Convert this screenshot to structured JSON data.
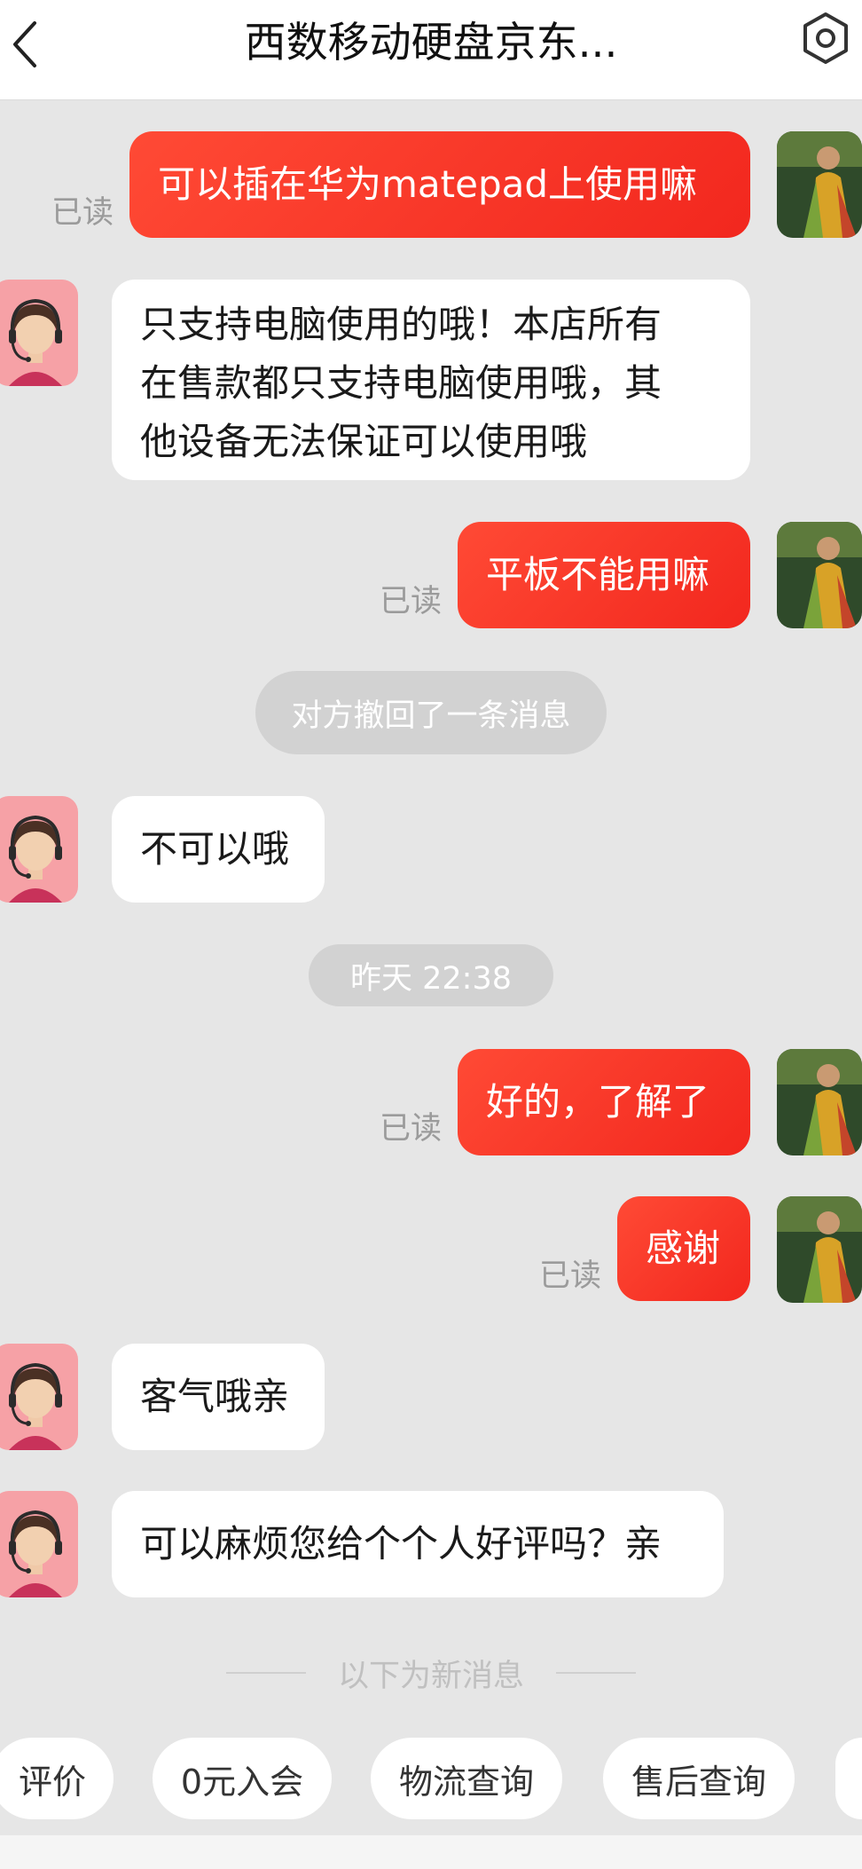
{
  "header": {
    "title": "西数移动硬盘京东..."
  },
  "messages": {
    "m1": {
      "text": "可以插在华为matepad上使用嘛",
      "status": "已读"
    },
    "m2": {
      "line1": "只支持电脑使用的哦！本店所有",
      "line2": "在售款都只支持电脑使用哦，其",
      "line3": "他设备无法保证可以使用哦"
    },
    "m3": {
      "text": "平板不能用嘛",
      "status": "已读"
    },
    "recall": "对方撤回了一条消息",
    "m4": {
      "text": "不可以哦"
    },
    "timestamp": "昨天  22:38",
    "m5": {
      "text": "好的，了解了",
      "status": "已读"
    },
    "m6": {
      "text": "感谢",
      "status": "已读"
    },
    "m7": {
      "text": "客气哦亲"
    },
    "m8": {
      "text": "可以麻烦您给个个人好评吗？亲"
    },
    "new_divider": "以下为新消息"
  },
  "quick_actions": [
    "评价",
    "0元入会",
    "物流查询",
    "售后查询"
  ],
  "colors": {
    "my_bubble": "#f2271e",
    "their_bubble": "#ffffff",
    "background": "#e6e6e6"
  },
  "icons": {
    "back": "chevron-left-icon",
    "settings": "hexagon-gear-icon",
    "agent_avatar": "headset-agent-icon",
    "user_avatar": "user-photo"
  }
}
